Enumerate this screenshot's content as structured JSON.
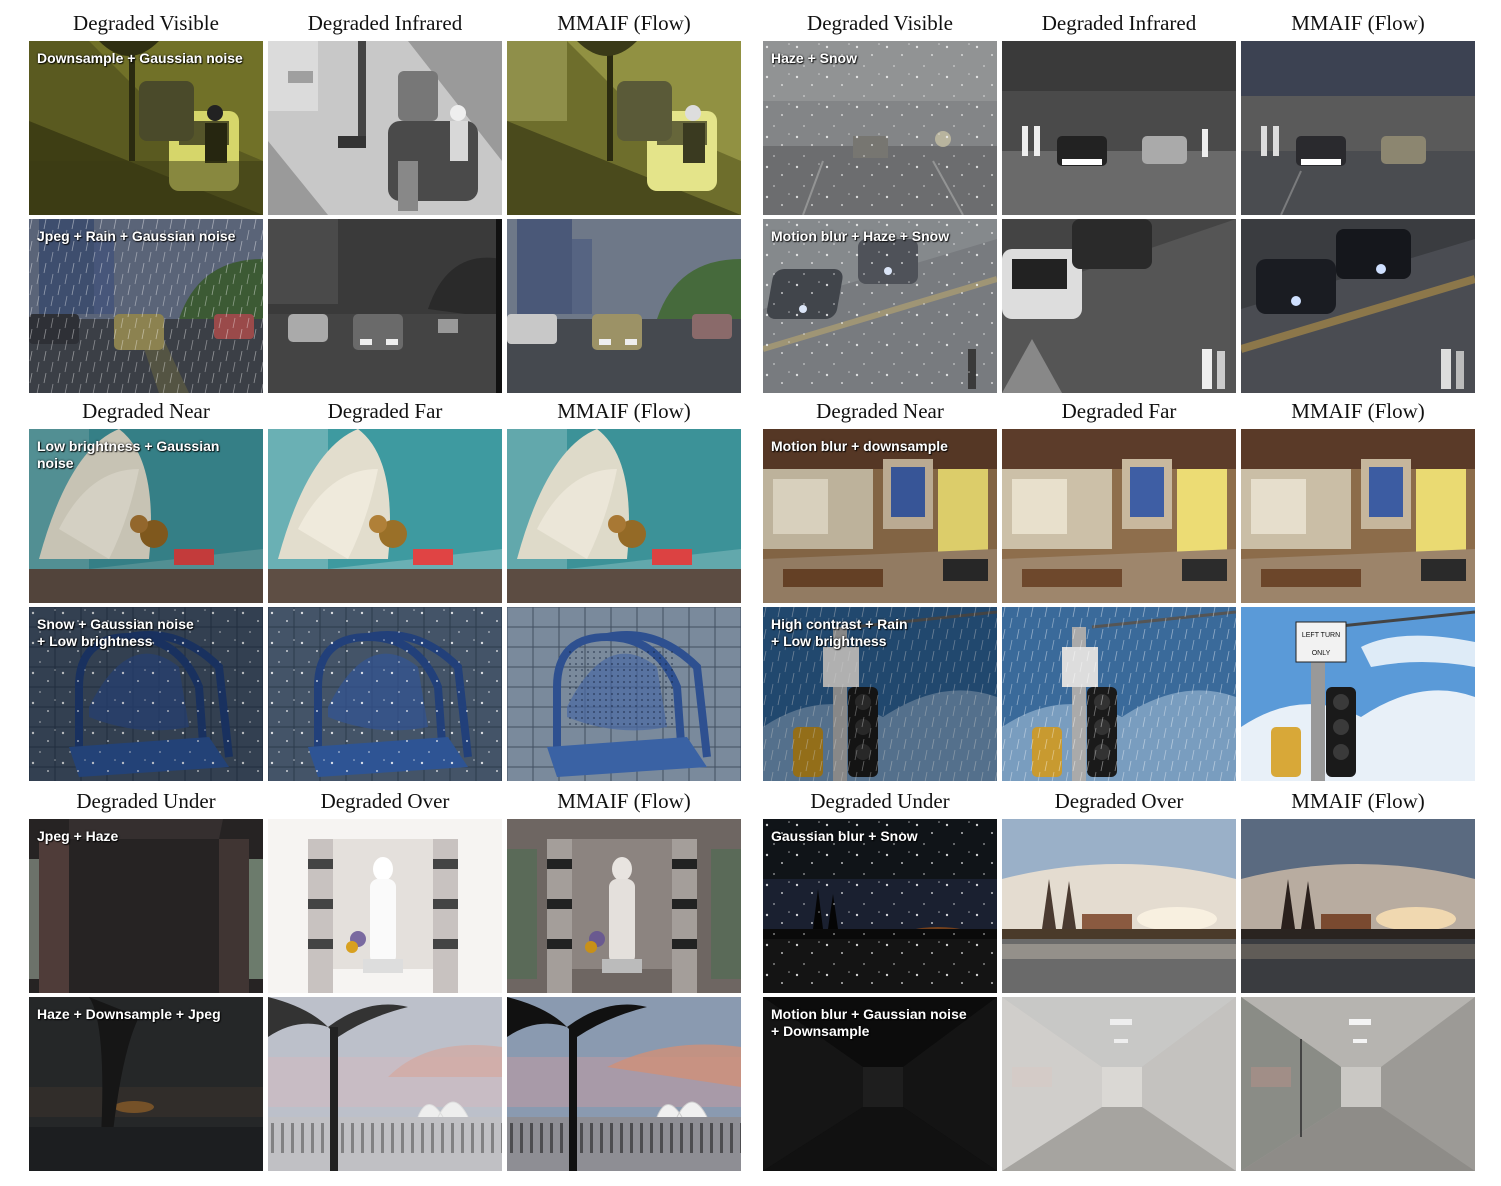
{
  "headers": {
    "vi": [
      "Degraded Visible",
      "Degraded Infrared",
      "MMAIF (Flow)"
    ],
    "nf": [
      "Degraded Near",
      "Degraded Far",
      "MMAIF (Flow)"
    ],
    "ue": [
      "Degraded Under",
      "Degraded Over",
      "MMAIF (Flow)"
    ]
  },
  "captions": {
    "l1": "Downsample + Gaussian noise",
    "l2": "Jpeg + Rain + Gaussian noise",
    "l3": "Low brightness + Gaussian\nnoise",
    "l4": "Snow + Gaussian noise\n+ Low brightness",
    "l5": "Jpeg + Haze",
    "l6": "Haze + Downsample + Jpeg",
    "r1": "Haze + Snow",
    "r2": "Motion blur + Haze + Snow",
    "r3": "Motion blur + downsample",
    "r4": "High contrast + Rain\n+ Low brightness",
    "r5": "Gaussian blur + Snow",
    "r6": "Motion blur + Gaussian noise\n+ Downsample"
  },
  "sign_text": {
    "left_turn": "LEFT TURN",
    "only": "ONLY"
  }
}
